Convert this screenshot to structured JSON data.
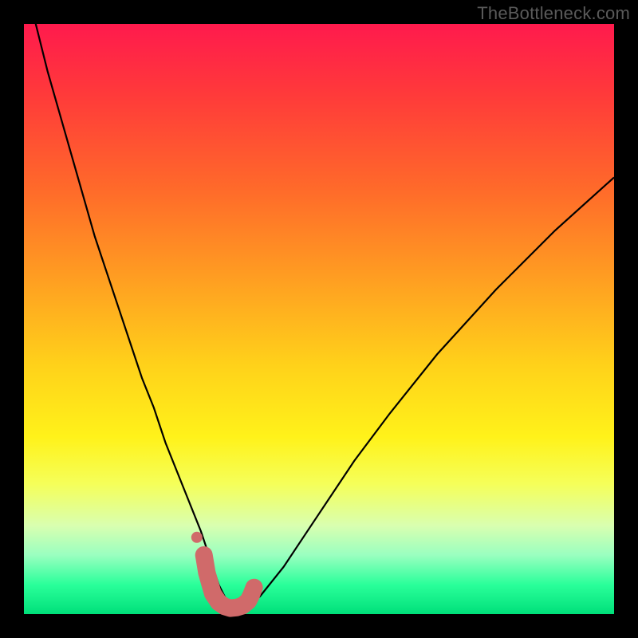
{
  "watermark": "TheBottleneck.com",
  "colors": {
    "background": "#000000",
    "curve_stroke": "#000000",
    "marker_fill": "#d06a6a",
    "watermark_text": "#5a5a5a"
  },
  "chart_data": {
    "type": "line",
    "title": "",
    "xlabel": "",
    "ylabel": "",
    "xlim": [
      0,
      100
    ],
    "ylim": [
      0,
      100
    ],
    "grid": false,
    "legend": false,
    "series": [
      {
        "name": "bottleneck-curve",
        "x": [
          0,
          2,
          4,
          6,
          8,
          10,
          12,
          14,
          16,
          18,
          20,
          22,
          24,
          26,
          28,
          30,
          32,
          33,
          34,
          35,
          36,
          37,
          38,
          40,
          44,
          50,
          56,
          62,
          70,
          80,
          90,
          100
        ],
        "values": [
          108,
          100,
          92,
          85,
          78,
          71,
          64,
          58,
          52,
          46,
          40,
          35,
          29,
          24,
          19,
          14,
          8,
          5,
          3,
          1.5,
          1,
          1,
          1.5,
          3,
          8,
          17,
          26,
          34,
          44,
          55,
          65,
          74
        ]
      }
    ],
    "markers": {
      "name": "bottleneck-range",
      "x": [
        30.5,
        31,
        32,
        33,
        34,
        35,
        36,
        37,
        38,
        38.5,
        39
      ],
      "values": [
        10,
        7,
        3.5,
        2,
        1.3,
        1,
        1.1,
        1.4,
        2.2,
        3.2,
        4.5
      ]
    }
  }
}
